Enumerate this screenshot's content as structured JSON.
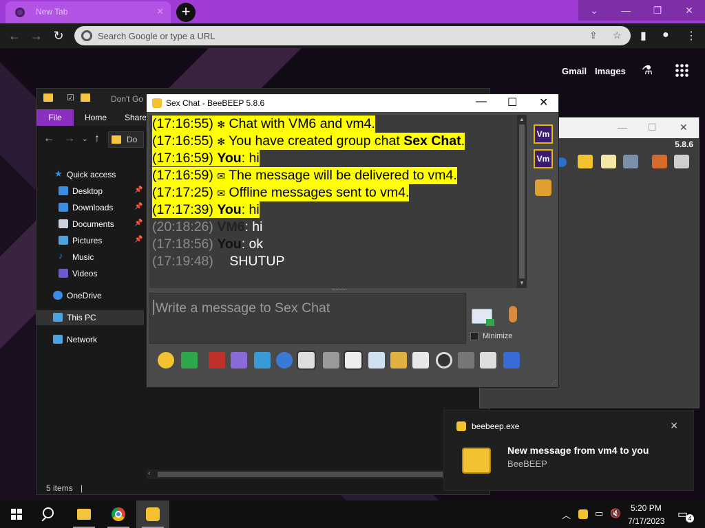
{
  "browser": {
    "tab_title": "New Tab",
    "new_tab_label": "+",
    "omnibox_placeholder": "Search Google or type a URL",
    "page_links": {
      "gmail": "Gmail",
      "images": "Images"
    }
  },
  "explorer": {
    "title": "Don't Go",
    "ribbon": {
      "file": "File",
      "home": "Home",
      "share": "Share"
    },
    "crumb": "Do",
    "nav": [
      {
        "label": "Quick access",
        "icon": "star-icon"
      },
      {
        "label": "Desktop",
        "icon": "desktop-icon",
        "pinned": true
      },
      {
        "label": "Downloads",
        "icon": "download-icon",
        "pinned": true
      },
      {
        "label": "Documents",
        "icon": "documents-icon",
        "pinned": true
      },
      {
        "label": "Pictures",
        "icon": "pictures-icon",
        "pinned": true
      },
      {
        "label": "Music",
        "icon": "music-icon"
      },
      {
        "label": "Videos",
        "icon": "videos-icon"
      },
      {
        "label": "OneDrive",
        "icon": "cloud-icon"
      },
      {
        "label": "This PC",
        "icon": "computer-icon",
        "selected": true
      },
      {
        "label": "Network",
        "icon": "network-icon"
      }
    ],
    "status": "5 items"
  },
  "beebeep_main": {
    "version": "5.8.6"
  },
  "chat": {
    "window_title": "Sex Chat - BeeBEEP 5.8.6",
    "messages": [
      {
        "time": "(17:16:55)",
        "text": "Chat with VM6 and vm4.",
        "highlight": true,
        "emoji": "✻"
      },
      {
        "time": "(17:16:55)",
        "prefix": "You have created group chat ",
        "bold": "Sex Chat",
        "suffix": ".",
        "highlight": true,
        "emoji": "✻"
      },
      {
        "time": "(17:16:59)",
        "bold": "You",
        "suffix": ": hi",
        "highlight": true
      },
      {
        "time": "(17:16:59)",
        "text": "The message will be delivered to vm4.",
        "highlight": true,
        "emoji": "✉"
      },
      {
        "time": "(17:17:25)",
        "text": "Offline messages sent to vm4.",
        "highlight": true,
        "emoji": "✉"
      },
      {
        "time": "(17:17:39)",
        "bold": "You",
        "suffix": ": hi",
        "highlight": true
      },
      {
        "time": "(20:18:26)",
        "bold": "VM6",
        "suffix": ": hi",
        "highlight": false
      },
      {
        "time": "(17:18:56)",
        "bold": "You",
        "suffix": ": ok",
        "highlight": false
      },
      {
        "time": "(17:19:48)",
        "text": "SHUTUP",
        "highlight": false
      }
    ],
    "members": [
      "Vm",
      "Vm"
    ],
    "input_placeholder": "Write a message to Sex Chat",
    "minimize_label": "Minimize"
  },
  "toast": {
    "app": "beebeep.exe",
    "title": "New message from vm4 to you",
    "body": "BeeBEEP"
  },
  "taskbar": {
    "time": "5:20 PM",
    "date": "7/17/2023",
    "notification_count": "4"
  }
}
